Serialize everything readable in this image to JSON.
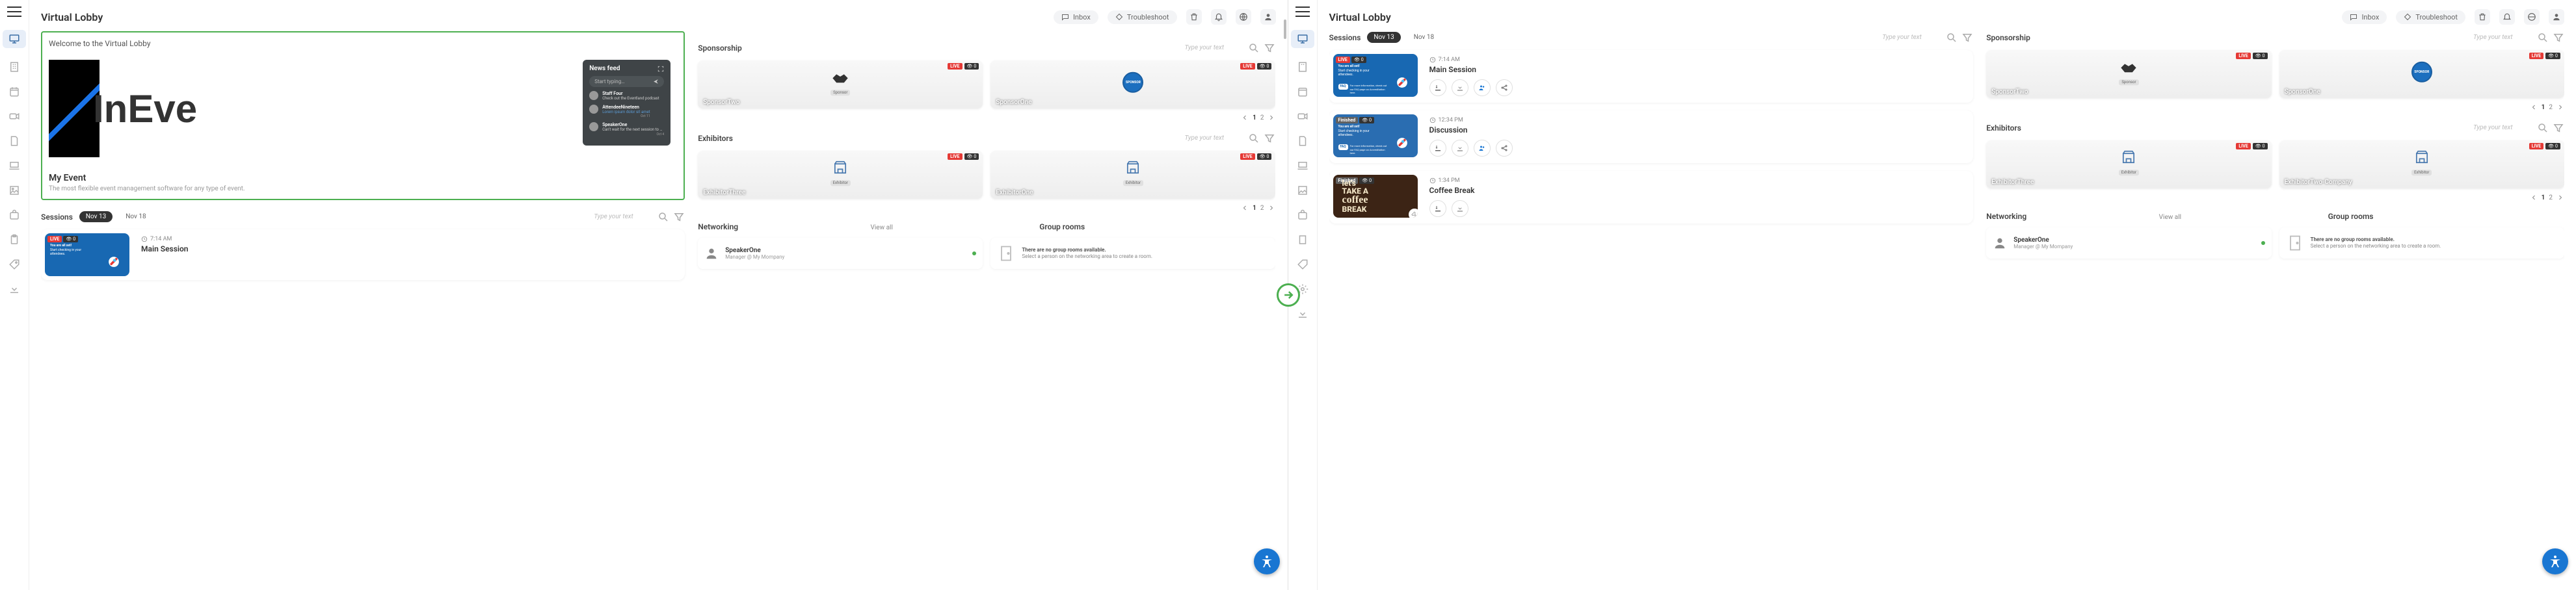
{
  "header": {
    "title": "Virtual Lobby",
    "inbox": "Inbox",
    "troubleshoot": "Troubleshoot"
  },
  "welcome": {
    "heading": "Welcome to the Virtual Lobby",
    "logo_text": "InEve",
    "event_title": "My Event",
    "event_subtitle": "The most flexible event management software for any type of event."
  },
  "newsfeed": {
    "title": "News feed",
    "placeholder": "Start typing…",
    "items": [
      {
        "name": "Staff Four",
        "text": "Check out the Eventland podcast",
        "date": ""
      },
      {
        "name": "AttendeeNineteen",
        "text": "",
        "date": "Oct 11"
      },
      {
        "name": "SpeakerOne",
        "text": "Can't wait for the next session to start!",
        "date": "Oct 4"
      }
    ]
  },
  "sessions": {
    "title": "Sessions",
    "dates": [
      "Nov 13",
      "Nov 18"
    ],
    "search_placeholder": "Type your text",
    "items": [
      {
        "status": "LIVE",
        "count": "0",
        "time": "7:14 AM",
        "name": "Main Session",
        "thumb_line1": "You are all set!",
        "thumb_line2": "Start checking in your attendees.",
        "faq": "For more information, check out our FAQ page on Accreditation here."
      },
      {
        "status": "Finished",
        "count": "0",
        "time": "12:34 PM",
        "name": "Discussion",
        "thumb_line1": "You are all set!",
        "thumb_line2": "Start checking in your attendees.",
        "faq": "For more information, check out our FAQ page on Accreditation here."
      },
      {
        "status": "Finished",
        "count": "0",
        "time": "1:34 PM",
        "name": "Coffee Break",
        "coffee": true
      }
    ]
  },
  "sponsorship": {
    "title": "Sponsorship",
    "search_placeholder": "Type your text",
    "items": [
      {
        "status": "LIVE",
        "count": "0",
        "label": "Sponsor",
        "name": "SponsorTwo",
        "icon": "handshake"
      },
      {
        "status": "LIVE",
        "count": "0",
        "label": "SPONSOR",
        "name": "SponsorOne",
        "icon": "sponsor-circle"
      }
    ],
    "page_current": "1",
    "page_total": "2"
  },
  "exhibitors": {
    "title": "Exhibitors",
    "search_placeholder": "Type your text",
    "items_left": [
      {
        "status": "LIVE",
        "count": "0",
        "label": "Exhibitor",
        "name": "ExhibitorThree"
      },
      {
        "status": "LIVE",
        "count": "0",
        "label": "Exhibitor",
        "name": "ExhibitorOne"
      }
    ],
    "items_right": [
      {
        "status": "LIVE",
        "count": "0",
        "label": "Exhibitor",
        "name": "ExhibitorThree"
      },
      {
        "status": "LIVE",
        "count": "0",
        "label": "Exhibitor",
        "name": "ExhibitorTwo-Company"
      }
    ],
    "page_current": "1",
    "page_total": "2"
  },
  "networking": {
    "title": "Networking",
    "viewall": "View all",
    "group_title": "Group rooms",
    "person": {
      "name": "SpeakerOne",
      "role": "Manager @ My Mompany"
    },
    "group_empty_title": "There are no group rooms available.",
    "group_empty_sub": "Select a person on the networking area to create a room."
  }
}
